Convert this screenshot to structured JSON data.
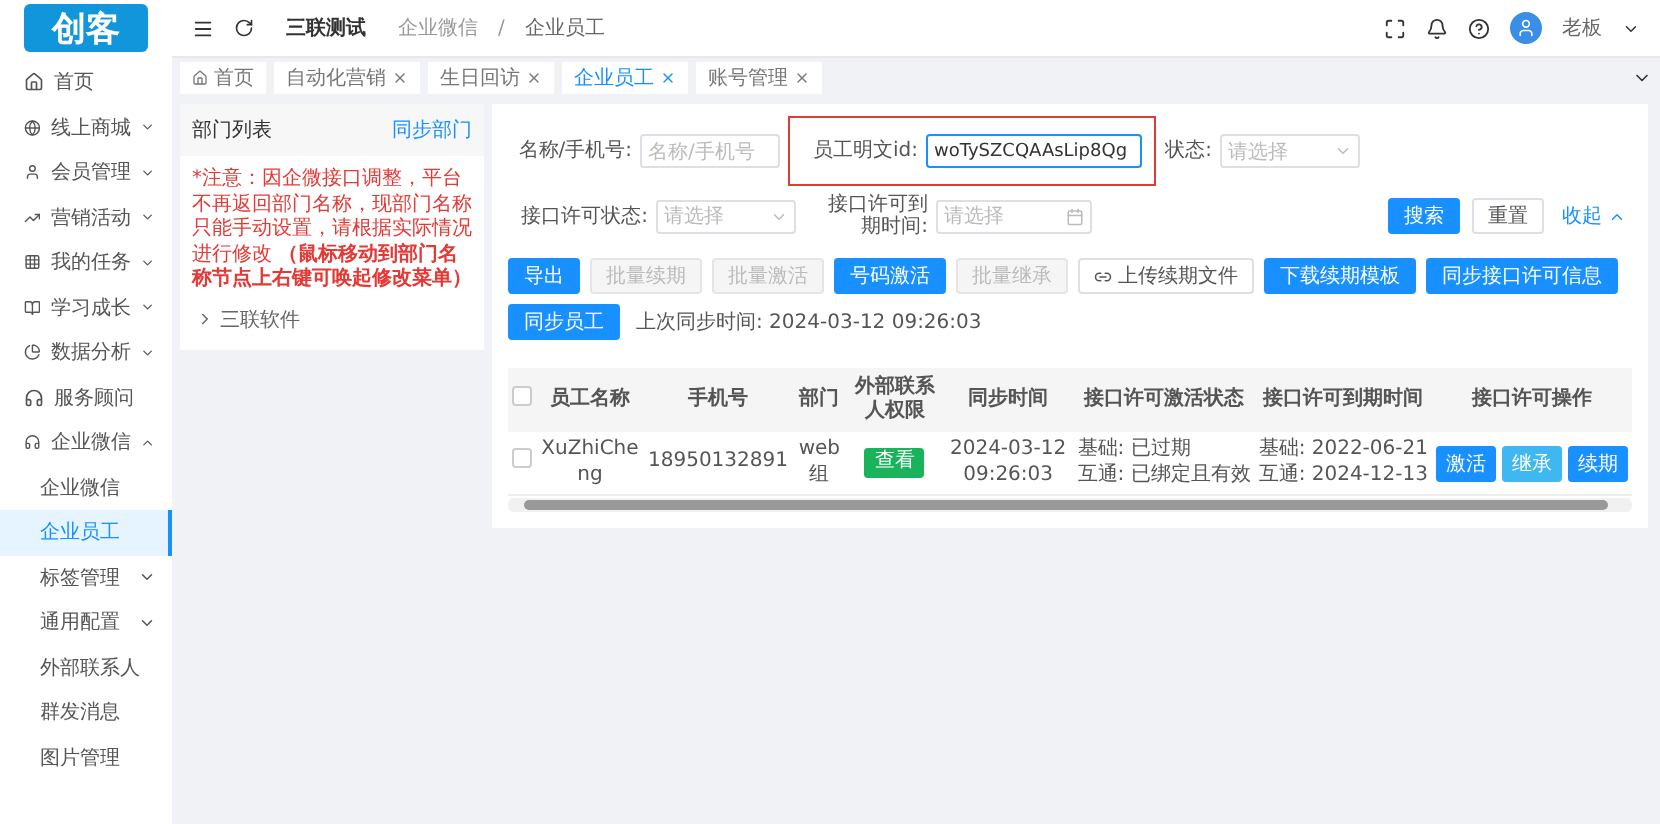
{
  "logo": "创客",
  "header": {
    "title": "三联测试",
    "breadcrumb": [
      "企业微信",
      "企业员工"
    ],
    "separator": "/",
    "user": "老板"
  },
  "sidebar": {
    "items": [
      {
        "label": "首页",
        "has_children": false,
        "selected": false
      },
      {
        "label": "线上商城",
        "has_children": true,
        "selected": false
      },
      {
        "label": "会员管理",
        "has_children": true,
        "selected": false
      },
      {
        "label": "营销活动",
        "has_children": true,
        "selected": false
      },
      {
        "label": "我的任务",
        "has_children": true,
        "selected": false
      },
      {
        "label": "学习成长",
        "has_children": true,
        "selected": false
      },
      {
        "label": "数据分析",
        "has_children": true,
        "selected": false
      },
      {
        "label": "服务顾问",
        "has_children": false,
        "selected": false
      },
      {
        "label": "企业微信",
        "has_children": true,
        "expanded": true,
        "selected": false,
        "children": [
          {
            "label": "企业微信",
            "has_children": false,
            "selected": false
          },
          {
            "label": "企业员工",
            "has_children": false,
            "selected": true
          },
          {
            "label": "标签管理",
            "has_children": true,
            "selected": false
          },
          {
            "label": "通用配置",
            "has_children": true,
            "selected": false
          },
          {
            "label": "外部联系人",
            "has_children": false,
            "selected": false
          },
          {
            "label": "群发消息",
            "has_children": false,
            "selected": false
          },
          {
            "label": "图片管理",
            "has_children": false,
            "selected": false
          }
        ]
      }
    ]
  },
  "tabs": [
    {
      "label": "首页",
      "closable": false,
      "selected": false
    },
    {
      "label": "自动化营销",
      "closable": true,
      "selected": false
    },
    {
      "label": "生日回访",
      "closable": true,
      "selected": false
    },
    {
      "label": "企业员工",
      "closable": true,
      "selected": true
    },
    {
      "label": "账号管理",
      "closable": true,
      "selected": false
    }
  ],
  "department_panel": {
    "title": "部门列表",
    "sync_link": "同步部门",
    "notice": "*注意：因企微接口调整，平台不再返回部门名称，现部门名称只能手动设置，请根据实际情况进行修改 **（鼠标移动到部门名称节点上右键可唤起修改菜单）**",
    "tree": [
      {
        "label": "三联软件",
        "expanded": false
      }
    ]
  },
  "filters": [
    {
      "label": "名称/手机号:",
      "kind": "text",
      "placeholder": "名称/手机号",
      "highlighted": false
    },
    {
      "label": "员工明文id:",
      "kind": "text",
      "value": "woTySZCQAAsLip8Qg",
      "highlighted": true
    },
    {
      "label": "状态:",
      "kind": "select",
      "placeholder": "请选择",
      "highlighted": false
    },
    {
      "label": "接口许可状态:",
      "kind": "select",
      "placeholder": "请选择",
      "highlighted": false
    },
    {
      "label": "接口许可到期时间:",
      "kind": "date",
      "placeholder": "请选择",
      "highlighted": false
    }
  ],
  "filter_buttons": [
    {
      "label": "搜索",
      "kind": "primary"
    },
    {
      "label": "重置",
      "kind": "default"
    },
    {
      "label": "收起",
      "kind": "link"
    }
  ],
  "actions": [
    {
      "label": "导出",
      "kind": "primary"
    },
    {
      "label": "批量续期",
      "kind": "disabled"
    },
    {
      "label": "批量激活",
      "kind": "disabled"
    },
    {
      "label": "号码激活",
      "kind": "primary"
    },
    {
      "label": "批量继承",
      "kind": "disabled"
    },
    {
      "label": "上传续期文件",
      "kind": "upload"
    },
    {
      "label": "下载续期模板",
      "kind": "primary"
    },
    {
      "label": "同步接口许可信息",
      "kind": "primary"
    },
    {
      "label": "同步员工",
      "kind": "primary"
    }
  ],
  "last_sync": "上次同步时间: 2024-03-12 09:26:03",
  "table": {
    "all_checked": false,
    "columns": [
      "员工名称",
      "手机号",
      "部门",
      "外部联系人权限",
      "同步时间",
      "接口许可激活状态",
      "接口许可到期时间",
      "接口许可操作"
    ],
    "rows": [
      {
        "checked": false,
        "name": "XuZhiCheng",
        "phone": "18950132891",
        "dept": "web组",
        "permission": "查看",
        "sync_time": "2024-03-12 09:26:03",
        "status": [
          "基础: 已过期",
          "互通: 已绑定且有效"
        ],
        "expire": [
          "基础: 2022-06-21",
          "互通: 2024-12-13"
        ],
        "operations": [
          {
            "label": "激活",
            "kind": "primary"
          },
          {
            "label": "继承",
            "kind": "info"
          },
          {
            "label": "续期",
            "kind": "primary"
          }
        ]
      }
    ]
  }
}
